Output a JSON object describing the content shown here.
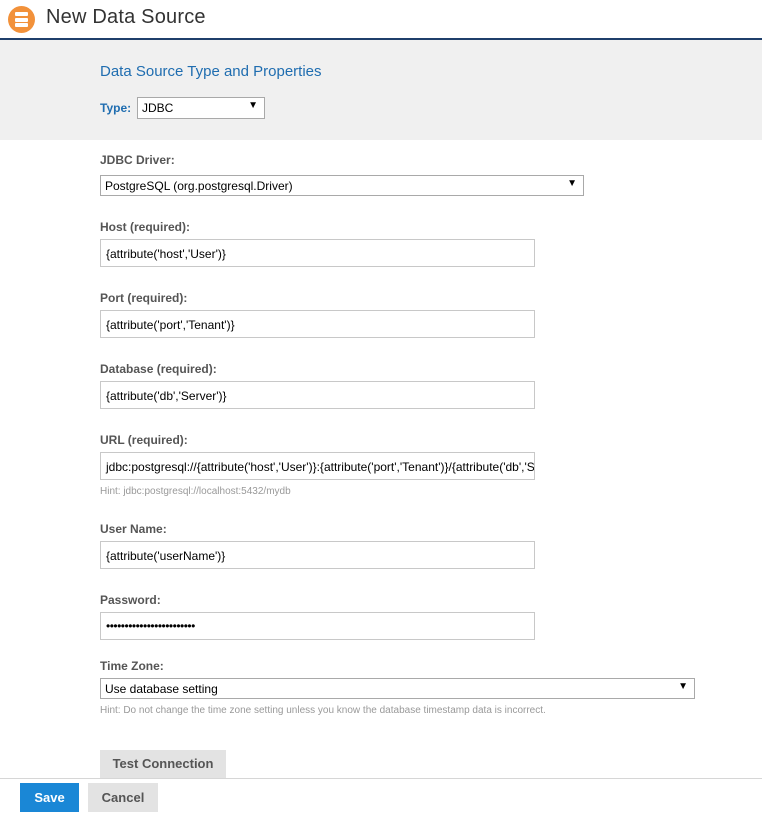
{
  "header": {
    "title": "New Data Source",
    "icon": "database-icon",
    "accent": "#f2913a"
  },
  "type_panel": {
    "section_title": "Data Source Type and Properties",
    "type_label": "Type:",
    "type_value": "JDBC"
  },
  "form": {
    "driver": {
      "label": "JDBC Driver:",
      "value": "PostgreSQL (org.postgresql.Driver)"
    },
    "host": {
      "label": "Host (required):",
      "value": "{attribute('host','User')}"
    },
    "port": {
      "label": "Port (required):",
      "value": "{attribute('port','Tenant')}"
    },
    "database": {
      "label": "Database (required):",
      "value": "{attribute('db','Server')}"
    },
    "url": {
      "label": "URL (required):",
      "value": "jdbc:postgresql://{attribute('host','User')}:{attribute('port','Tenant')}/{attribute('db','Server')}",
      "hint": "Hint: jdbc:postgresql://localhost:5432/mydb"
    },
    "username": {
      "label": "User Name:",
      "value": "{attribute('userName')}"
    },
    "password": {
      "label": "Password:",
      "value": "••••••••••••••••••••••••"
    },
    "timezone": {
      "label": "Time Zone:",
      "value": "Use database setting",
      "hint": "Hint: Do not change the time zone setting unless you know the database timestamp data is incorrect."
    }
  },
  "buttons": {
    "test": "Test Connection",
    "save": "Save",
    "cancel": "Cancel"
  },
  "colors": {
    "primary": "#1a87d6",
    "heading": "#1f6db0",
    "header_rule": "#1f3f6b"
  }
}
